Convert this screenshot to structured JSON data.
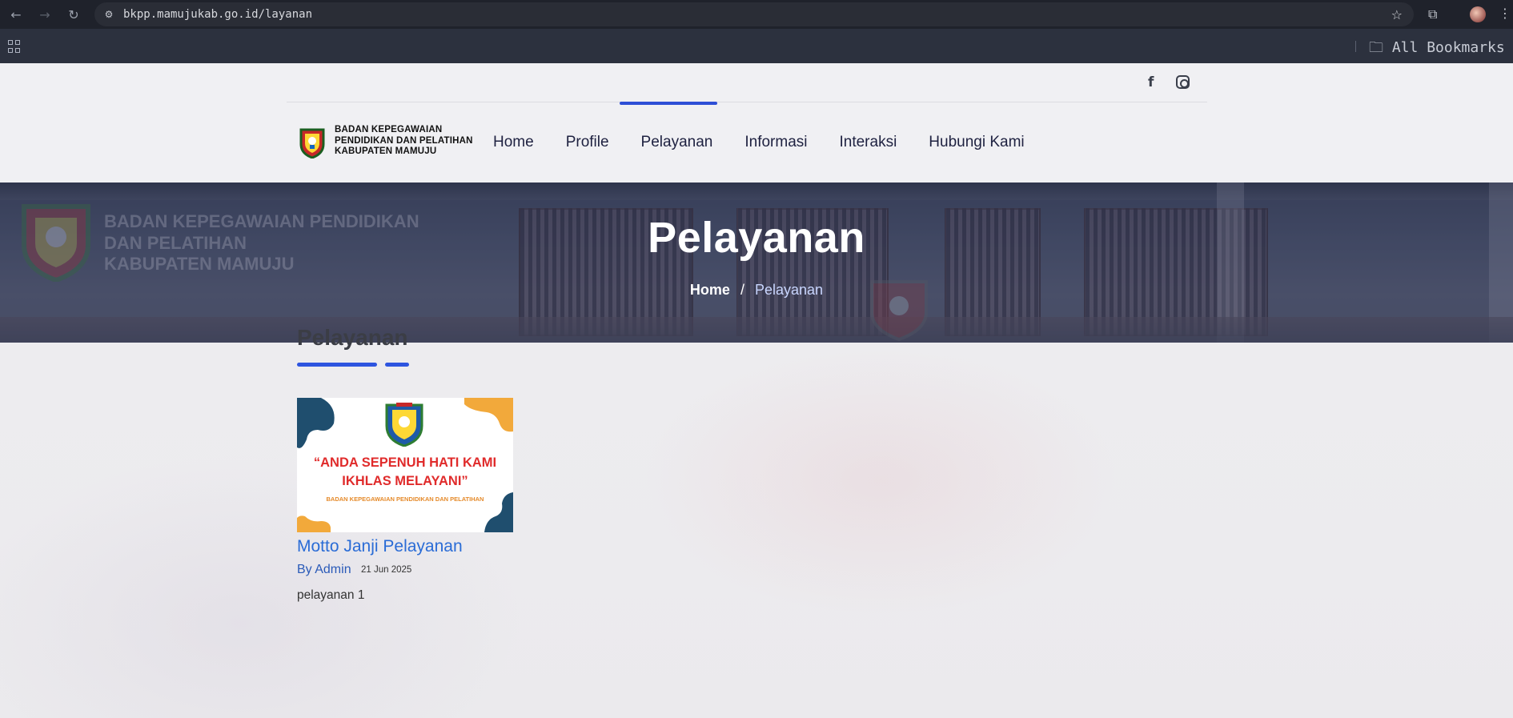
{
  "browser": {
    "url": "bkpp.mamujukab.go.id/layanan",
    "bookmarks_label": "All Bookmarks"
  },
  "site": {
    "logo_lines": [
      "BADAN KEPEGAWAIAN",
      "PENDIDIKAN DAN PELATIHAN",
      "KABUPATEN MAMUJU"
    ],
    "nav": [
      "Home",
      "Profile",
      "Pelayanan",
      "Informasi",
      "Interaksi",
      "Hubungi Kami"
    ],
    "active_nav": "Pelayanan",
    "social": {
      "facebook": "f"
    }
  },
  "hero": {
    "sign_lines": [
      "BADAN KEPEGAWAIAN PENDIDIKAN",
      "DAN PELATIHAN",
      "KABUPATEN MAMUJU"
    ],
    "title": "Pelayanan",
    "breadcrumb_home": "Home",
    "breadcrumb_sep": "/",
    "breadcrumb_current": "Pelayanan"
  },
  "content": {
    "section_title": "Pelayanan",
    "card": {
      "image_quote_line1": "“ANDA SEPENUH HATI KAMI",
      "image_quote_line2": "IKHLAS MELAYANI”",
      "image_subtitle": "BADAN KEPEGAWAIAN PENDIDIKAN DAN PELATIHAN",
      "title": "Motto Janji Pelayanan",
      "author": "By Admin",
      "date": "21 Jun 2025",
      "description": "pelayanan 1"
    }
  },
  "colors": {
    "accent": "#2e4fd6",
    "link": "#2a6cd6",
    "quote": "#e02b2b",
    "blob_dark": "#1f4e6e",
    "blob_orange": "#f2a93b"
  }
}
